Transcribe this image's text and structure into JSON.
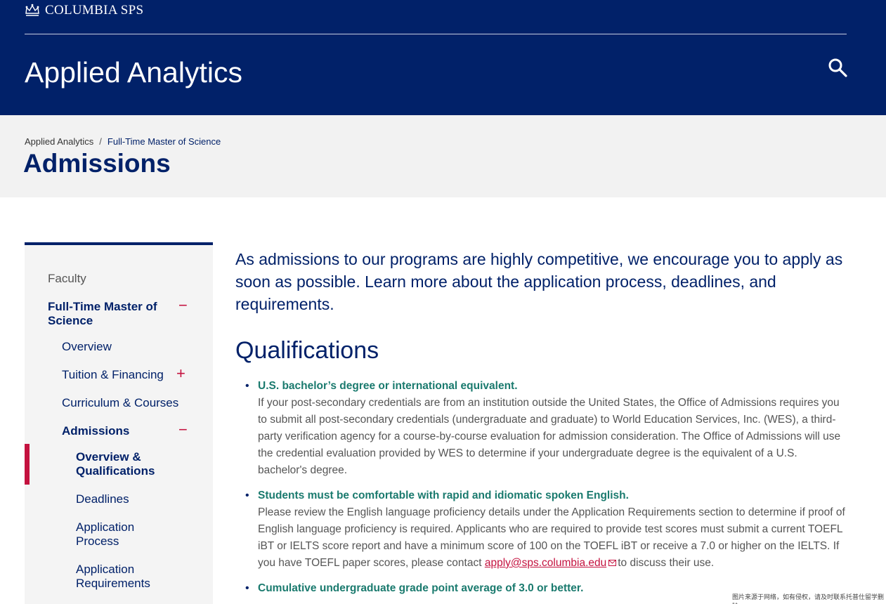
{
  "header": {
    "logo_text": "COLUMBIA SPS",
    "site_title": "Applied Analytics"
  },
  "title_band": {
    "breadcrumb": [
      "Applied Analytics",
      "Full-Time Master of Science"
    ],
    "breadcrumb_separator": "/",
    "page_title": "Admissions"
  },
  "sidebar": {
    "items": {
      "faculty": "Faculty",
      "ftms": "Full-Time Master of Science",
      "overview": "Overview",
      "tuition": "Tuition & Financing",
      "curriculum": "Curriculum & Courses",
      "admissions": "Admissions",
      "overview_quals": "Overview & Qualifications",
      "deadlines": "Deadlines",
      "app_process": "Application Process",
      "app_requirements": "Application Requirements"
    },
    "toggle_minus": "−",
    "toggle_plus": "+"
  },
  "main": {
    "intro": "As admissions to our programs are highly competitive, we encourage you to apply as soon as possible. Learn more about the application process, deadlines, and requirements.",
    "qualifications_heading": "Qualifications",
    "qualifications": {
      "q1_head": "U.S. bachelor’s degree or international equivalent.",
      "q1_body": "If your post-secondary credentials are from an institution outside the United States, the Office of Admissions requires you to submit all post-secondary credentials (undergraduate and graduate) to World Education Services, Inc. (WES), a third-party verification agency for a course-by-course evaluation for admission consideration. The Office of Admissions will use the credential evaluation provided by WES to determine if your undergraduate degree is the equivalent of a U.S. bachelor's degree.",
      "q2_head": "Students must be comfortable with rapid and idiomatic spoken English.",
      "q2_body_before": "Please review the English language proficiency details under the Application Requirements section to determine if proof of English language proficiency is required. Applicants who are required to provide test scores must submit a current TOEFL iBT or IELTS score report and have a minimum score of 100 on the TOEFL iBT or receive a 7.0 or higher on the IELTS. If you have TOEFL paper scores, please contact",
      "q2_email": "apply@sps.columbia.edu",
      "q2_body_after": "to discuss their use.",
      "q3_head": "Cumulative undergraduate grade point average of 3.0 or better."
    }
  },
  "watermark": "图片来源于网络，如有侵权，请及时联系托普仕留学删除",
  "colors": {
    "navy": "#012169",
    "accent_red": "#c4123f",
    "teal": "#1a7a6e",
    "band_gray": "#f2f2f2"
  },
  "icons": [
    "crown-icon",
    "search-icon",
    "mail-icon"
  ]
}
